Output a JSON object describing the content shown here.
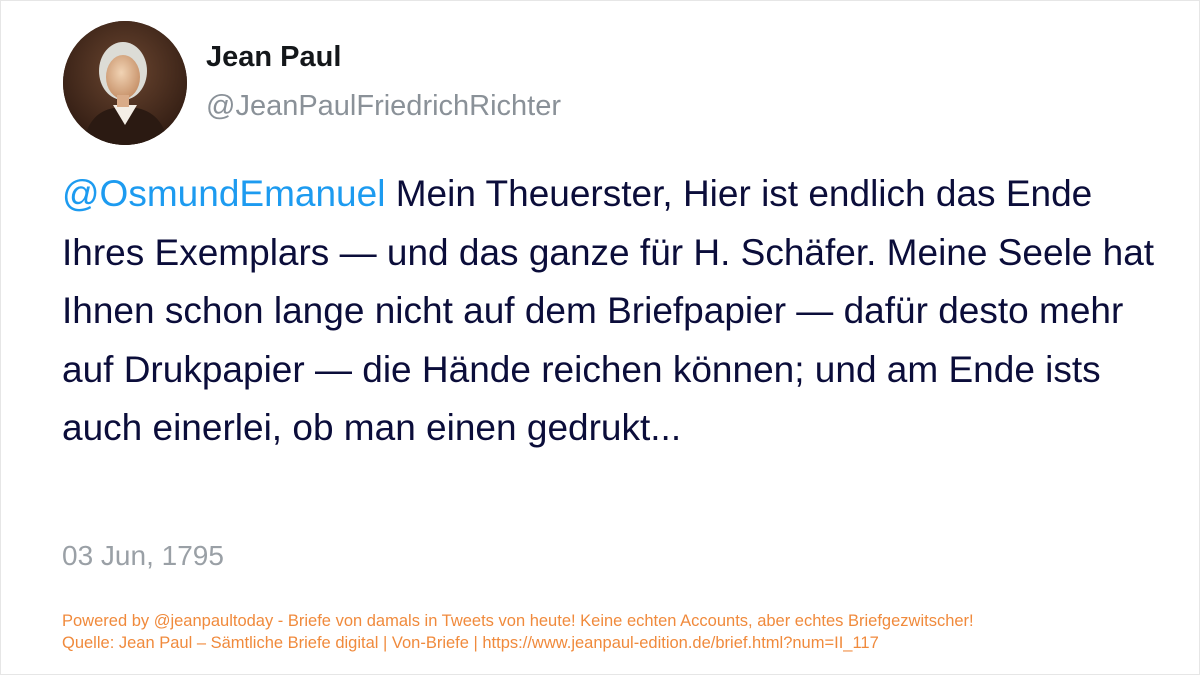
{
  "author": {
    "avatar_icon": "portrait-avatar",
    "display_name": "Jean Paul",
    "handle": "@JeanPaulFriedrichRichter"
  },
  "tweet": {
    "mention": "@OsmundEmanuel",
    "text": " Mein Theuerster, Hier ist endlich das Ende Ihres Exemplars — und das ganze für H. Schäfer. Meine Seele hat Ihnen schon lange nicht auf dem Briefpapier — dafür desto mehr auf Drukpapier — die Hände reichen können; und am Ende ists auch einerlei, ob man einen gedrukt...",
    "date": "03 Jun, 1795"
  },
  "footer": {
    "powered_by": "Powered by @jeanpaultoday - Briefe von damals in Tweets von heute! Keine echten Accounts, aber echtes Briefgezwitscher!",
    "source": "Quelle: Jean Paul – Sämtliche Briefe digital | Von-Briefe | https://www.jeanpaul-edition.de/brief.html?num=II_117"
  },
  "colors": {
    "mention": "#1d9bf0",
    "text": "#0b0d3a",
    "footer": "#f08a3c",
    "muted": "#9aa0a6"
  }
}
